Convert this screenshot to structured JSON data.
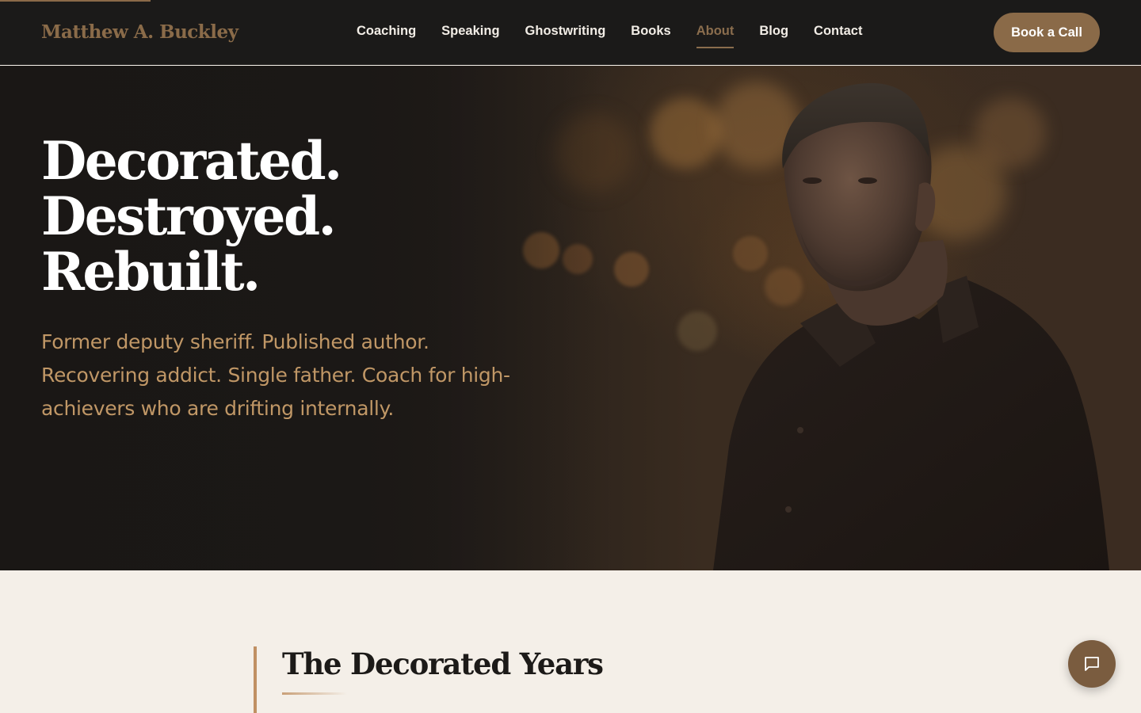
{
  "header": {
    "brand": "Matthew A. Buckley",
    "nav": [
      {
        "label": "Coaching",
        "active": false
      },
      {
        "label": "Speaking",
        "active": false
      },
      {
        "label": "Ghostwriting",
        "active": false
      },
      {
        "label": "Books",
        "active": false
      },
      {
        "label": "About",
        "active": true
      },
      {
        "label": "Blog",
        "active": false
      },
      {
        "label": "Contact",
        "active": false
      }
    ],
    "cta_label": "Book a Call"
  },
  "hero": {
    "title_lines": [
      "Decorated.",
      "Destroyed.",
      "Rebuilt."
    ],
    "subtitle": "Former deputy sheriff. Published author. Recovering addict. Single father. Coach for high-achievers who are drifting internally."
  },
  "story": {
    "section_title": "The Decorated Years"
  },
  "chat": {
    "icon": "chat-bubble-icon"
  },
  "colors": {
    "accent": "#8a6a48",
    "header_bg": "#1b1a19",
    "hero_subtitle": "#c09766",
    "section_bg": "#f4efe8"
  }
}
